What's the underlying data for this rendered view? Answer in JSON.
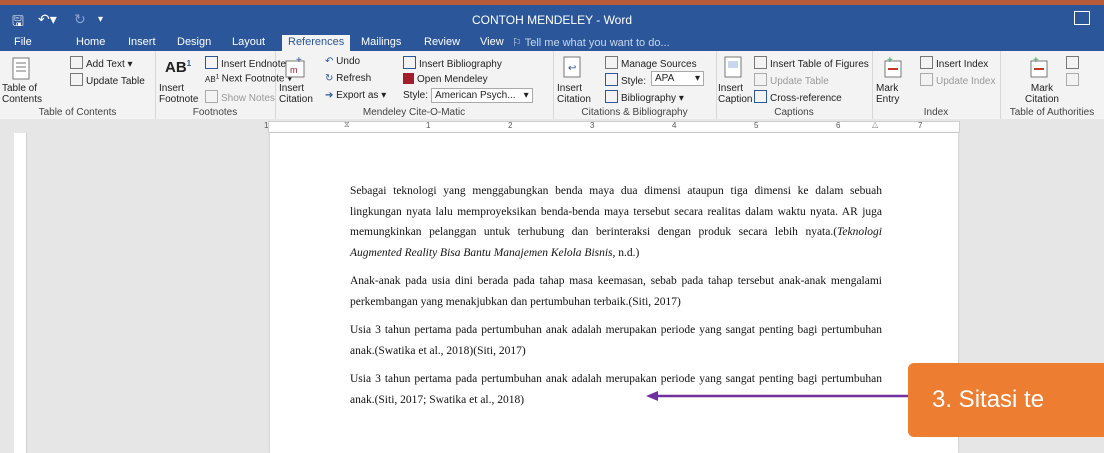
{
  "window": {
    "title": "CONTOH MENDELEY - Word"
  },
  "tabs": [
    "File",
    "Home",
    "Insert",
    "Design",
    "Layout",
    "References",
    "Mailings",
    "Review",
    "View"
  ],
  "active_tab": "References",
  "tell_me": "Tell me what you want to do...",
  "ribbon": {
    "toc": {
      "table_of_contents": "Table of Contents",
      "add_text": "Add Text",
      "update_table": "Update Table",
      "label": "Table of Contents"
    },
    "footnotes": {
      "insert_footnote": "Insert Footnote",
      "insert_endnote": "Insert Endnote",
      "next_footnote": "Next Footnote",
      "show_notes": "Show Notes",
      "label": "Footnotes"
    },
    "mendeley": {
      "insert_citation": "Insert Citation",
      "undo": "Undo",
      "refresh": "Refresh",
      "export_as": "Export as",
      "insert_bibliography": "Insert Bibliography",
      "open_mendeley": "Open Mendeley",
      "style_label": "Style:",
      "style_value": "American Psych...",
      "label": "Mendeley Cite-O-Matic"
    },
    "citations": {
      "insert_citation": "Insert Citation",
      "manage_sources": "Manage Sources",
      "style_label": "Style:",
      "style_value": "APA",
      "bibliography": "Bibliography",
      "label": "Citations & Bibliography"
    },
    "captions": {
      "insert_caption": "Insert Caption",
      "insert_table_of_figures": "Insert Table of Figures",
      "update_table": "Update Table",
      "cross_reference": "Cross-reference",
      "label": "Captions"
    },
    "index": {
      "mark_entry": "Mark Entry",
      "insert_index": "Insert Index",
      "update_index": "Update Index",
      "label": "Index"
    },
    "authorities": {
      "mark_citation": "Mark Citation",
      "label": "Table of Authorities"
    }
  },
  "ruler": {
    "numbers": [
      "1",
      "1",
      "2",
      "3",
      "4",
      "5",
      "6",
      "7"
    ]
  },
  "document": {
    "p1": {
      "a": "Sebagai teknologi yang menggabungkan benda maya dua dimensi ataupun tiga dimensi ke dalam sebuah lingkungan nyata lalu memproyeksikan benda-benda maya tersebut secara realitas dalam waktu nyata. AR juga memungkinkan pelanggan untuk terhubung dan berinteraksi dengan produk secara lebih nyata.(",
      "italic": "Teknologi Augmented Reality Bisa Bantu Manajemen Kelola Bisnis",
      "b": ", n.d.)"
    },
    "p2": "Anak-anak pada usia dini berada pada tahap masa keemasan, sebab pada tahap tersebut anak-anak mengalami perkembangan yang menakjubkan dan pertumbuhan terbaik.(Siti, 2017)",
    "p3": "Usia 3 tahun pertama pada pertumbuhan anak adalah merupakan periode yang sangat penting bagi pertumbuhan anak.(Swatika et al., 2018)(Siti, 2017)",
    "p4": "Usia 3 tahun pertama pada pertumbuhan anak adalah merupakan periode yang sangat penting bagi pertumbuhan anak.(Siti, 2017; Swatika et al., 2018)"
  },
  "callout": {
    "text": "3. Sitasi te",
    "color": "#ed7d31"
  },
  "colors": {
    "word_blue": "#2b579a",
    "arrow": "#7030a0"
  }
}
